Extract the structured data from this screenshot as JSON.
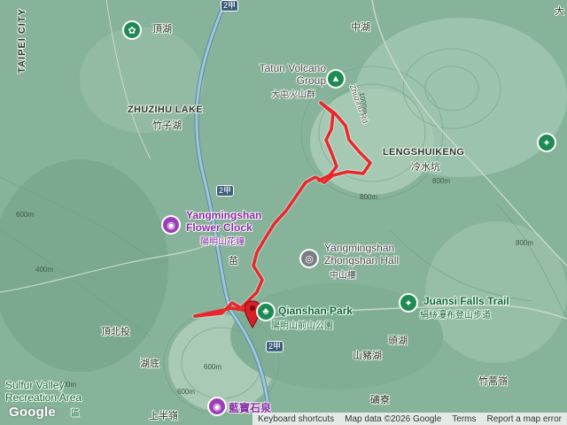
{
  "map": {
    "places": {
      "taipei_city": "TAIPEI CITY",
      "dinghu": "頂湖",
      "zhonghu": "中湖",
      "zhuzihu_lake": "ZHUZIHU LAKE",
      "zhuzihu_zh": "竹子湖",
      "lengshuikeng": "LENGSHUIKENG",
      "lengshuikeng_zh": "冷水坑",
      "miaopu": "苗",
      "dingbeitou": "頂北投",
      "hudi": "湖底",
      "toutou": "頭湖",
      "shanzhuhu": "山豬湖",
      "kuangliao": "礦寮",
      "zhuhaoling": "竹蒿嶺",
      "shangbanling": "上半嶺",
      "da": "大"
    },
    "pois": {
      "tatun_name": "Tatun Volcano Group",
      "tatun_zh": "大屯火山群",
      "flower_clock_name": "Yangmingshan Flower Clock",
      "flower_clock_zh": "陽明山花鐘",
      "zhongshan_hall_name": "Yangmingshan Zhongshan Hall",
      "zhongshan_hall_zh": "中山樓",
      "qianshan_park_name": "Qianshan Park",
      "qianshan_park_zh": "陽明山前山公園",
      "juansi_name": "Juansi Falls Trail",
      "juansi_zh": "絹絲瀑布登山步道",
      "sulfur_valley_name": "Sulfur Valley Recreation Area",
      "sulfur_valley_zh": "區",
      "lanbao_zh": "藍寶石泉"
    },
    "roads": {
      "zhuzihu_rd": "Zhuzihu Rd",
      "route_2jia": "2甲"
    },
    "elevations": [
      "800m",
      "1000m",
      "800m",
      "600m",
      "800m",
      "600m",
      "400m",
      "600m",
      "400m"
    ],
    "icons": {
      "tatun": "mountain-icon",
      "flower_clock": "camera-icon",
      "zhongshan_hall": "landmark-icon",
      "qianshan_park": "tree-icon",
      "juansi": "hiking-icon",
      "lanbao": "camera-icon",
      "dinghu_poi": "flower-icon",
      "da_poi": "hiking-icon",
      "track_start": "map-pin-icon"
    },
    "colors": {
      "track": "#e8282d",
      "terrain": "#86b39a",
      "poi_green": "#1f8a52",
      "poi_purple": "#9c3fb7",
      "poi_grey": "#7b7f84"
    }
  },
  "attribution": {
    "logo": "Google",
    "keyboard_shortcuts": "Keyboard shortcuts",
    "map_data": "Map data ©2026 Google",
    "terms": "Terms",
    "report": "Report a map error"
  }
}
